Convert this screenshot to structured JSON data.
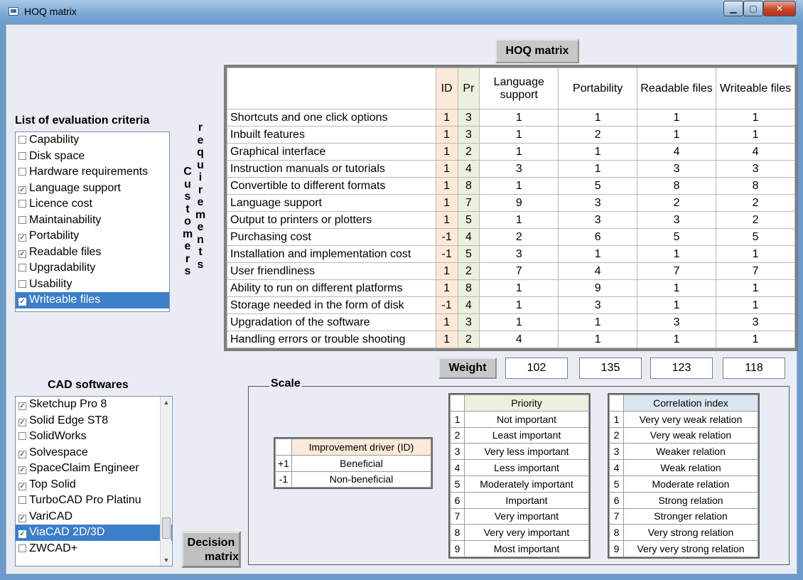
{
  "window": {
    "title": "HOQ matrix"
  },
  "caption_buttons": {
    "min": "▁",
    "max": "▢",
    "close": "✕"
  },
  "hoq_button": "HOQ matrix",
  "grid": {
    "headers": [
      "ID",
      "Pr",
      "Language support",
      "Portability",
      "Readable files",
      "Writeable files"
    ],
    "rows": [
      {
        "req": "Shortcuts and one click options",
        "id": "1",
        "pr": "3",
        "v": [
          "1",
          "1",
          "1",
          "1"
        ]
      },
      {
        "req": "Inbuilt features",
        "id": "1",
        "pr": "3",
        "v": [
          "1",
          "2",
          "1",
          "1"
        ]
      },
      {
        "req": "Graphical interface",
        "id": "1",
        "pr": "2",
        "v": [
          "1",
          "1",
          "4",
          "4"
        ]
      },
      {
        "req": "Instruction manuals or tutorials",
        "id": "1",
        "pr": "4",
        "v": [
          "3",
          "1",
          "3",
          "3"
        ]
      },
      {
        "req": "Convertible to different formats",
        "id": "1",
        "pr": "8",
        "v": [
          "1",
          "5",
          "8",
          "8"
        ]
      },
      {
        "req": "Language support",
        "id": "1",
        "pr": "7",
        "v": [
          "9",
          "3",
          "2",
          "2"
        ]
      },
      {
        "req": "Output to printers or plotters",
        "id": "1",
        "pr": "5",
        "v": [
          "1",
          "3",
          "3",
          "2"
        ]
      },
      {
        "req": "Purchasing cost",
        "id": "-1",
        "pr": "4",
        "v": [
          "2",
          "6",
          "5",
          "5"
        ]
      },
      {
        "req": "Installation and implementation cost",
        "id": "-1",
        "pr": "5",
        "v": [
          "3",
          "1",
          "1",
          "1"
        ]
      },
      {
        "req": "User friendliness",
        "id": "1",
        "pr": "2",
        "v": [
          "7",
          "4",
          "7",
          "7"
        ]
      },
      {
        "req": "Ability to run on different platforms",
        "id": "1",
        "pr": "8",
        "v": [
          "1",
          "9",
          "1",
          "1"
        ]
      },
      {
        "req": "Storage needed in the form of disk",
        "id": "-1",
        "pr": "4",
        "v": [
          "1",
          "3",
          "1",
          "1"
        ]
      },
      {
        "req": "Upgradation of the software",
        "id": "1",
        "pr": "3",
        "v": [
          "1",
          "1",
          "3",
          "3"
        ]
      },
      {
        "req": "Handling errors or trouble shooting",
        "id": "1",
        "pr": "2",
        "v": [
          "4",
          "1",
          "1",
          "1"
        ]
      }
    ]
  },
  "criteria": {
    "title": "List of evaluation criteria",
    "items": [
      {
        "label": "Capability",
        "checked": false
      },
      {
        "label": "Disk space",
        "checked": false
      },
      {
        "label": "Hardware requirements",
        "checked": false
      },
      {
        "label": "Language support",
        "checked": true
      },
      {
        "label": "Licence cost",
        "checked": false
      },
      {
        "label": "Maintainability",
        "checked": false
      },
      {
        "label": "Portability",
        "checked": true
      },
      {
        "label": "Readable files",
        "checked": true
      },
      {
        "label": "Upgradability",
        "checked": false
      },
      {
        "label": "Usability",
        "checked": false
      },
      {
        "label": "Writeable files",
        "checked": true,
        "selected": true
      }
    ]
  },
  "vertical": {
    "customers": "Customers",
    "requirements": "requirements"
  },
  "cad": {
    "title": "CAD softwares",
    "items": [
      {
        "label": "Sketchup Pro 8",
        "checked": true
      },
      {
        "label": "Solid Edge ST8",
        "checked": true
      },
      {
        "label": "SolidWorks",
        "checked": false
      },
      {
        "label": "Solvespace",
        "checked": true
      },
      {
        "label": "SpaceClaim Engineer",
        "checked": true
      },
      {
        "label": "Top Solid",
        "checked": true
      },
      {
        "label": "TurboCAD Pro Platinu",
        "checked": false
      },
      {
        "label": "VariCAD",
        "checked": true
      },
      {
        "label": "ViaCAD 2D/3D",
        "checked": true,
        "selected": true
      },
      {
        "label": "ZWCAD+",
        "checked": false
      }
    ]
  },
  "decision_button": {
    "line1": "Decision",
    "line2": "matrix"
  },
  "weight": {
    "label": "Weight",
    "values": [
      "102",
      "135",
      "123",
      "118"
    ]
  },
  "scale": {
    "label": "Scale",
    "improvement": {
      "header": "Improvement driver (ID)",
      "rows": [
        [
          "+1",
          "Beneficial"
        ],
        [
          "-1",
          "Non-beneficial"
        ]
      ]
    },
    "priority": {
      "header": "Priority",
      "rows": [
        [
          "1",
          "Not important"
        ],
        [
          "2",
          "Least important"
        ],
        [
          "3",
          "Very less important"
        ],
        [
          "4",
          "Less important"
        ],
        [
          "5",
          "Moderately important"
        ],
        [
          "6",
          "Important"
        ],
        [
          "7",
          "Very important"
        ],
        [
          "8",
          "Very very important"
        ],
        [
          "9",
          "Most important"
        ]
      ]
    },
    "correlation": {
      "header": "Correlation index",
      "rows": [
        [
          "1",
          "Very very weak relation"
        ],
        [
          "2",
          "Very weak relation"
        ],
        [
          "3",
          "Weaker relation"
        ],
        [
          "4",
          "Weak relation"
        ],
        [
          "5",
          "Moderate relation"
        ],
        [
          "6",
          "Strong relation"
        ],
        [
          "7",
          "Stronger relation"
        ],
        [
          "8",
          "Very strong relation"
        ],
        [
          "9",
          "Very very strong relation"
        ]
      ]
    }
  },
  "colors": {
    "id_bg": "#fde9d9",
    "pr_bg": "#ebf1de",
    "selection": "#3c7fc9"
  }
}
